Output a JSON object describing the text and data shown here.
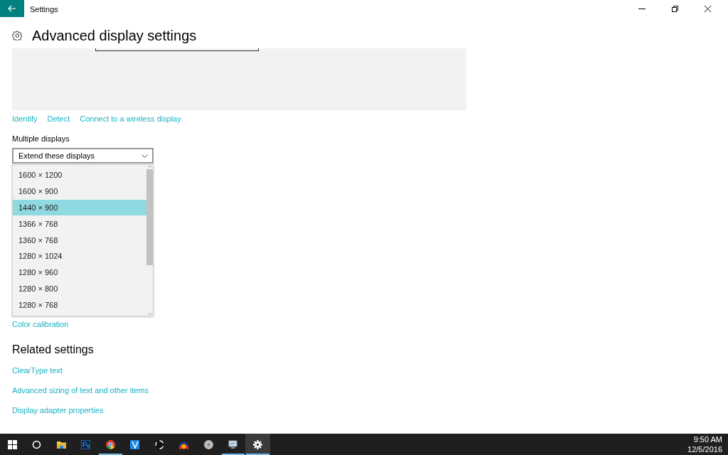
{
  "window": {
    "title": "Settings"
  },
  "page": {
    "title": "Advanced display settings"
  },
  "display_links": [
    "Identify",
    "Detect",
    "Connect to a wireless display"
  ],
  "multiple_displays": {
    "label": "Multiple displays",
    "value": "Extend these displays",
    "expanded": true
  },
  "resolution_options": [
    {
      "label": "1600 × 1200",
      "selected": false
    },
    {
      "label": "1600 × 900",
      "selected": false
    },
    {
      "label": "1440 × 900",
      "selected": true
    },
    {
      "label": "1366 × 768",
      "selected": false
    },
    {
      "label": "1360 × 768",
      "selected": false
    },
    {
      "label": "1280 × 1024",
      "selected": false
    },
    {
      "label": "1280 × 960",
      "selected": false
    },
    {
      "label": "1280 × 800",
      "selected": false
    },
    {
      "label": "1280 × 768",
      "selected": false
    }
  ],
  "color_calibration_link": "Color calibration",
  "related_settings": {
    "title": "Related settings",
    "links": [
      "ClearType text",
      "Advanced sizing of text and other items",
      "Display adapter properties"
    ]
  },
  "taskbar": {
    "items": [
      {
        "kind": "start",
        "running": false,
        "active": false
      },
      {
        "kind": "search",
        "running": false,
        "active": false
      },
      {
        "kind": "folder",
        "running": false,
        "active": false
      },
      {
        "kind": "ps",
        "running": false,
        "active": false
      },
      {
        "kind": "browser",
        "running": true,
        "active": false
      },
      {
        "kind": "ide",
        "running": false,
        "active": false
      },
      {
        "kind": "aperture",
        "running": false,
        "active": false
      },
      {
        "kind": "headphones",
        "running": false,
        "active": false
      },
      {
        "kind": "disc",
        "running": false,
        "active": false
      },
      {
        "kind": "monitor",
        "running": true,
        "active": false
      },
      {
        "kind": "gear",
        "running": true,
        "active": true
      }
    ],
    "time": "9:50 AM",
    "date": "12/5/2016"
  }
}
